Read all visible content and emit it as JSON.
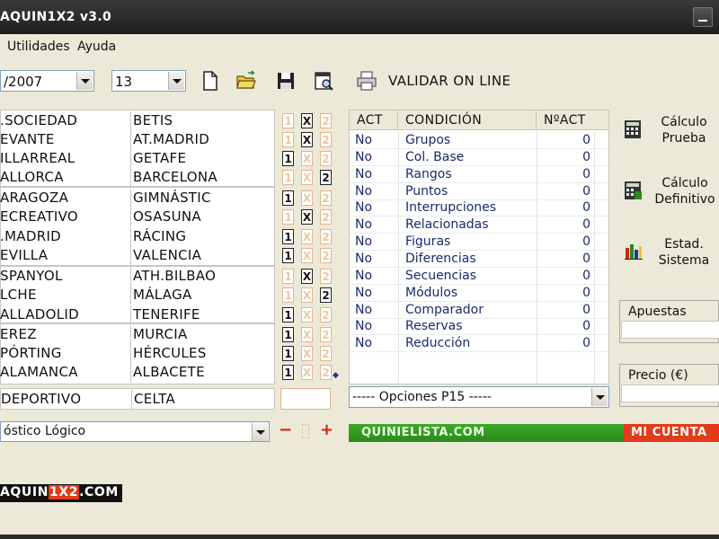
{
  "window": {
    "title": "AQUIN1X2 v3.0"
  },
  "menu": {
    "items": [
      "Utilidades",
      "Ayuda"
    ]
  },
  "toolbar": {
    "date_combo": "/2007",
    "jornada_combo": "13",
    "validar_label": "VALIDAR ON LINE",
    "icons": [
      "new-file-icon",
      "open-folder-icon",
      "save-disk-icon",
      "preview-icon",
      "printer-icon"
    ]
  },
  "matches": [
    {
      "home": ".SOCIEDAD",
      "away": "BETIS",
      "pick": "X"
    },
    {
      "home": "EVANTE",
      "away": "AT.MADRID",
      "pick": "X"
    },
    {
      "home": "ILLARREAL",
      "away": "GETAFE",
      "pick": "1"
    },
    {
      "home": "ALLORCA",
      "away": "BARCELONA",
      "pick": "2"
    },
    {
      "home": "ARAGOZA",
      "away": "GIMNÁSTIC",
      "pick": "1"
    },
    {
      "home": "ECREATIVO",
      "away": "OSASUNA",
      "pick": "X"
    },
    {
      "home": ".MADRID",
      "away": "RÁCING",
      "pick": "1"
    },
    {
      "home": "EVILLA",
      "away": "VALENCIA",
      "pick": "1"
    },
    {
      "home": "SPANYOL",
      "away": "ATH.BILBAO",
      "pick": "X"
    },
    {
      "home": "LCHE",
      "away": "MÁLAGA",
      "pick": "2"
    },
    {
      "home": "ALLADOLID",
      "away": "TENERIFE",
      "pick": "1"
    },
    {
      "home": "EREZ",
      "away": "MURCIA",
      "pick": "1"
    },
    {
      "home": "PÓRTING",
      "away": "HÉRCULES",
      "pick": "1"
    },
    {
      "home": "ALAMANCA",
      "away": "ALBACETE",
      "pick": "1"
    }
  ],
  "pleno": {
    "home": "DEPORTIVO",
    "away": "CELTA"
  },
  "pronostico_combo": "óstico Lógico",
  "pronostico_controls": {
    "minus": "−",
    "plus": "+"
  },
  "conditions": {
    "headers": [
      "ACT",
      "CONDICIÓN",
      "NºACT"
    ],
    "rows": [
      {
        "act": "No",
        "name": "Grupos",
        "count": "0"
      },
      {
        "act": "No",
        "name": "Col. Base",
        "count": "0"
      },
      {
        "act": "No",
        "name": "Rangos",
        "count": "0"
      },
      {
        "act": "No",
        "name": "Puntos",
        "count": "0"
      },
      {
        "act": "No",
        "name": "Interrupciones",
        "count": "0"
      },
      {
        "act": "No",
        "name": "Relacionadas",
        "count": "0"
      },
      {
        "act": "No",
        "name": "Figuras",
        "count": "0"
      },
      {
        "act": "No",
        "name": "Diferencias",
        "count": "0"
      },
      {
        "act": "No",
        "name": "Secuencias",
        "count": "0"
      },
      {
        "act": "No",
        "name": "Módulos",
        "count": "0"
      },
      {
        "act": "No",
        "name": "Comparador",
        "count": "0"
      },
      {
        "act": "No",
        "name": "Reservas",
        "count": "0"
      },
      {
        "act": "No",
        "name": "Reducción",
        "count": "0"
      }
    ]
  },
  "opciones_combo": "----- Opciones P15 -----",
  "side_buttons": {
    "calculo_prueba": "Cálculo\nPrueba",
    "calculo_definitivo": "Cálculo\nDefinitivo",
    "estadisticas": "Estad.\nSistema"
  },
  "fields": {
    "apuestas": "Apuestas",
    "precio": "Precio (€)"
  },
  "web_bar": {
    "link": "QUINIELISTA.COM",
    "account": "MI CUENTA"
  },
  "brand": {
    "prefix": "AQUIN",
    "mid": "1X2",
    "suffix": ".COM"
  },
  "colors": {
    "accent_green": "#2a8a1a",
    "accent_red": "#e23a1a",
    "pick_border_off": "#e2b48e"
  }
}
